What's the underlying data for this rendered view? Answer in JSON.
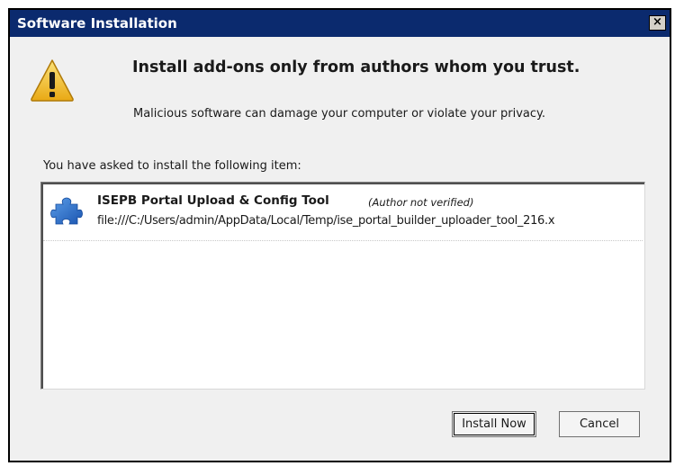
{
  "window": {
    "title": "Software Installation",
    "close_label": "×"
  },
  "warning": {
    "heading": "Install add-ons only from authors whom you trust.",
    "subtext": "Malicious software can damage your computer or violate your privacy."
  },
  "install_list": {
    "intro": "You have asked to install the following item:",
    "items": [
      {
        "name": "ISEPB Portal Upload & Config Tool",
        "author_status": "(Author not verified)",
        "url": "file:///C:/Users/admin/AppData/Local/Temp/ise_portal_builder_uploader_tool_216.x",
        "icon": "puzzle-piece-icon"
      }
    ]
  },
  "buttons": {
    "install_label": "Install Now",
    "cancel_label": "Cancel"
  },
  "colors": {
    "titlebar": "#0b2a6e",
    "warning_yellow": "#f2c12e",
    "puzzle_blue": "#2a6fc9"
  }
}
